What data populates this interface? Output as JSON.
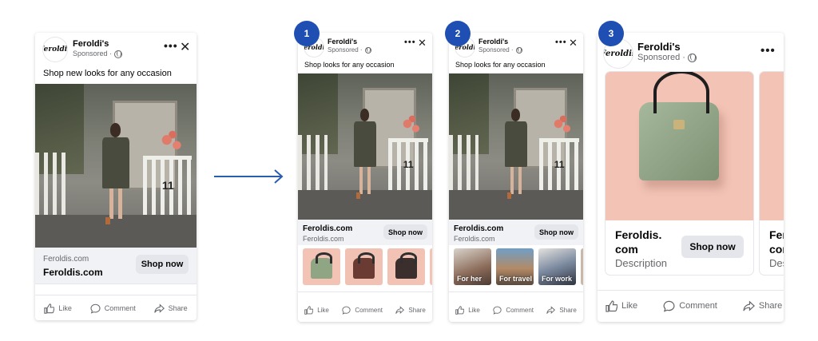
{
  "brand": "Feroldi's",
  "logo_text": "Feroldis",
  "sponsored": "Sponsored ·",
  "colors": {
    "accent": "#1f4fb3",
    "button_bg": "#e4e6eb",
    "strip_bg": "#f0f2f5",
    "product_bg": "#f3c3b5"
  },
  "actions": {
    "like": "Like",
    "comment": "Comment",
    "share": "Share"
  },
  "ad0": {
    "caption": "Shop new looks for any occasion",
    "url_small": "Feroldis.com",
    "url_bold": "Feroldis.com",
    "cta": "Shop now"
  },
  "ad1": {
    "step": "1",
    "caption": "Shop looks for any occasion",
    "url_bold": "Feroldis.com",
    "url_small": "Feroldis.com",
    "cta": "Shop now",
    "thumbs": [
      {
        "label": ""
      },
      {
        "label": ""
      },
      {
        "label": ""
      },
      {
        "label": ""
      }
    ]
  },
  "ad2": {
    "step": "2",
    "caption": "Shop looks for any occasion",
    "url_bold": "Feroldis.com",
    "url_small": "Feroldis.com",
    "cta": "Shop now",
    "thumbs": [
      {
        "label": "For her"
      },
      {
        "label": "For travel"
      },
      {
        "label": "For work"
      },
      {
        "label": ""
      }
    ]
  },
  "ad3": {
    "step": "3",
    "item1": {
      "title_line1": "Feroldis.",
      "title_line2": "com",
      "desc": "Description",
      "cta": "Shop now"
    },
    "item2": {
      "title_line1": "Fer",
      "title_line2": "cor",
      "desc": "Des"
    }
  }
}
